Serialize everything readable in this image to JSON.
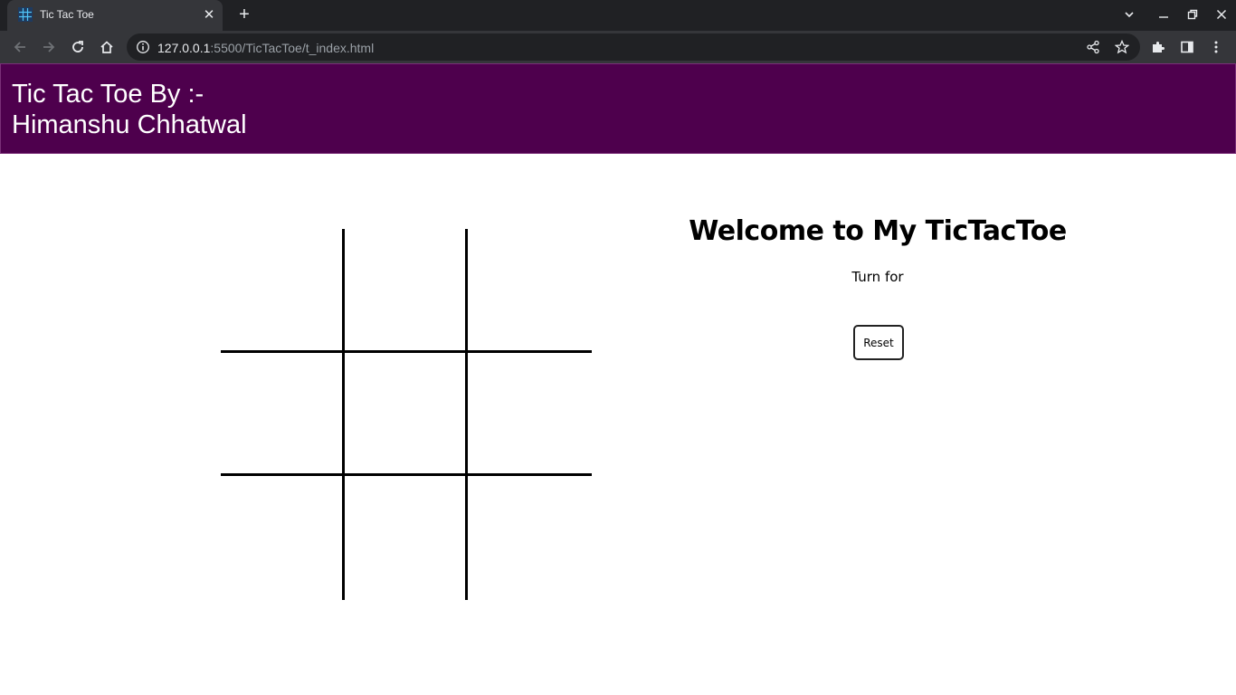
{
  "browser": {
    "tab_title": "Tic Tac Toe",
    "url_host": "127.0.0.1",
    "url_rest": ":5500/TicTacToe/t_index.html"
  },
  "header": {
    "line1": "Tic Tac Toe By :-",
    "line2": "Himanshu Chhatwal",
    "background": "#4e004d"
  },
  "board": {
    "cells": [
      "",
      "",
      "",
      "",
      "",
      "",
      "",
      "",
      ""
    ]
  },
  "info": {
    "welcome": "Welcome to My TicTacToe",
    "turn_label": "Turn for",
    "reset_label": "Reset"
  }
}
